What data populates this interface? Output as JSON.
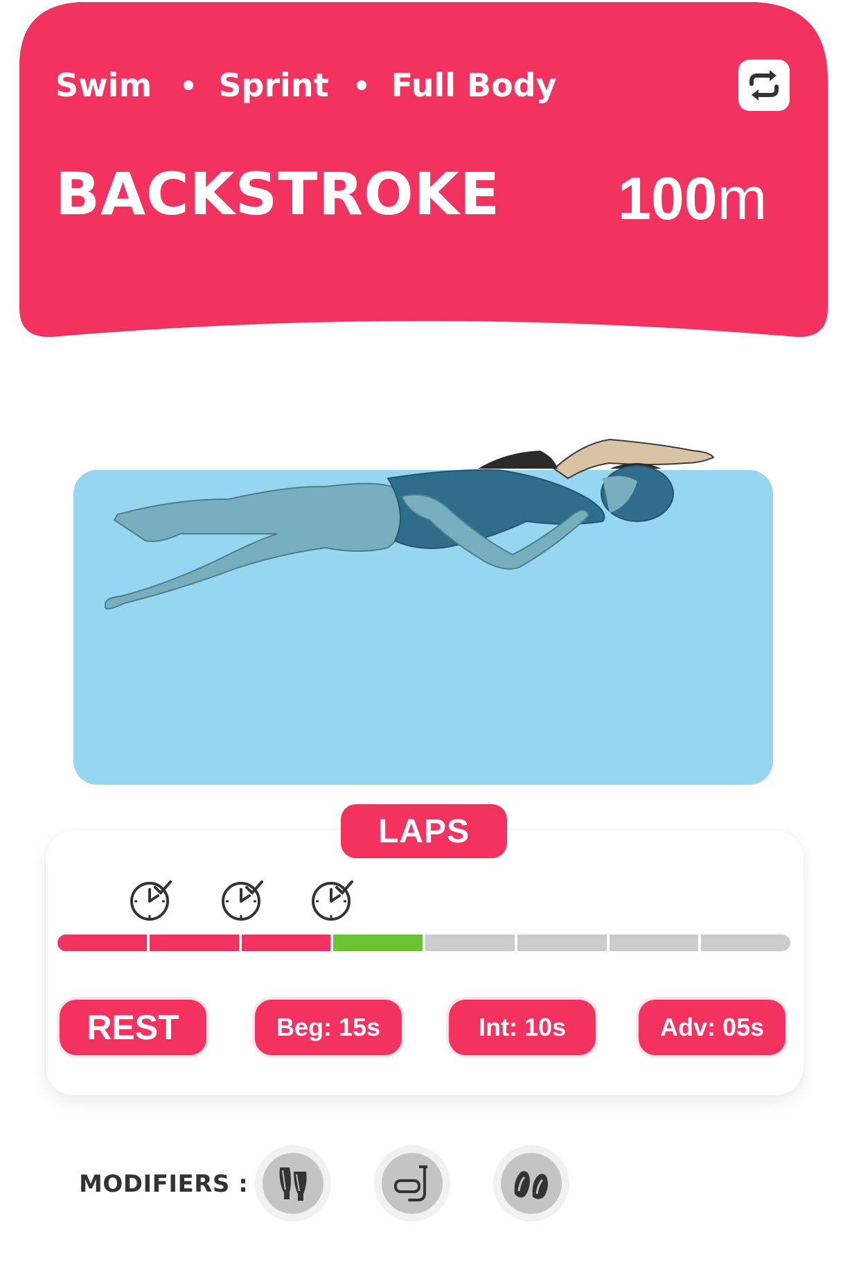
{
  "header": {
    "tags": [
      "Swim",
      "Sprint",
      "Full Body"
    ],
    "title": "BACKSTROKE",
    "distance_value": "100",
    "distance_unit": "m",
    "refresh_icon": "refresh-icon",
    "color": "#f2335f"
  },
  "illustration": {
    "subject": "swimmer-backstroke",
    "pool_color": "#97d6f1"
  },
  "laps": {
    "label": "LAPS",
    "total": 8,
    "completed": 3,
    "current": 4,
    "timed_laps": 3,
    "colors": {
      "completed": "#f2335f",
      "current": "#6cc334",
      "remaining": "#cccccc"
    }
  },
  "rest": {
    "label": "REST",
    "levels": [
      {
        "label": "Beg: 15s"
      },
      {
        "label": "Int: 10s"
      },
      {
        "label": "Adv: 05s"
      }
    ]
  },
  "modifiers": {
    "label": "MODIFIERS :",
    "items": [
      "fins-icon",
      "snorkel-icon",
      "paddles-icon"
    ]
  }
}
